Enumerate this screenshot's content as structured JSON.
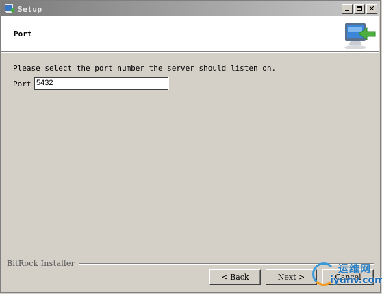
{
  "window": {
    "title": "Setup"
  },
  "header": {
    "title": "Port"
  },
  "main": {
    "prompt": "Please select the port number the server should listen on.",
    "port_label": "Port",
    "port_value": "5432"
  },
  "footer": {
    "brand": "BitRock Installer",
    "back_label": "< Back",
    "next_label": "Next >",
    "cancel_label": "Cancel"
  },
  "watermark": {
    "cn": "运维网",
    "en": "iyunv.com"
  },
  "icons": {
    "app": "setup-app-icon",
    "minimize": "minimize-icon",
    "maximize": "maximize-icon",
    "close": "close-icon",
    "header_logo": "computer-arrow-icon"
  },
  "colors": {
    "titlebar_start": "#7b7b7b",
    "titlebar_end": "#c8c8c8",
    "face": "#d4d0c8",
    "header_bg": "#ffffff"
  }
}
